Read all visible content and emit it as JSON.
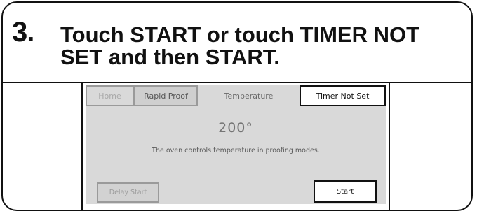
{
  "instruction": {
    "step_number": "3.",
    "line1": "Touch START or touch TIMER NOT",
    "line2": "SET and then START."
  },
  "screen": {
    "tabs": {
      "home": "Home",
      "rapid_proof": "Rapid Proof",
      "temperature": "Temperature",
      "timer": "Timer Not Set"
    },
    "temperature_value": "200°",
    "note": "The oven controls temperature in proofing modes.",
    "buttons": {
      "delay_start": "Delay Start",
      "start": "Start"
    }
  }
}
